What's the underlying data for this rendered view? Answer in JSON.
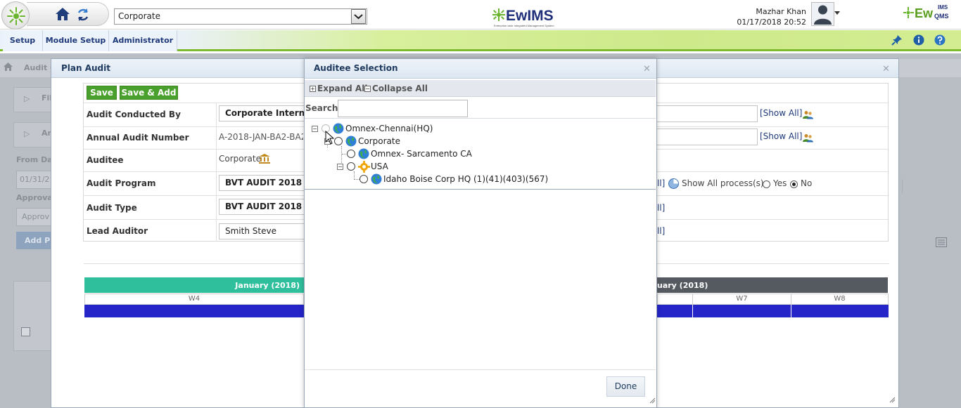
{
  "header": {
    "org_select_value": "Corporate",
    "center_logo": "EwIMS",
    "center_logo_tagline": "Enterprise wide Integrated Management System",
    "right_logo": "Ew",
    "right_logo_suffix": "QMS",
    "right_logo_top": "IMS",
    "user_name": "Mazhar Khan",
    "user_datetime": "01/17/2018 20:52"
  },
  "menu": {
    "items": [
      {
        "label": "Setup"
      },
      {
        "label": "Module Setup"
      },
      {
        "label": "Administrator"
      }
    ]
  },
  "background_page": {
    "breadcrumb": "Audit C",
    "filter_label": "Fil",
    "annual_label": "An",
    "from_date_label": "From Da",
    "from_date_value": "01/31/2",
    "approval_label": "Approva",
    "approval_placeholder": "Approv",
    "add_button": "Add P"
  },
  "plan_audit": {
    "title": "Plan Audit",
    "save_label": "Save",
    "save_add_label": "Save & Add",
    "show_all_label": "[Show All]",
    "rows": [
      {
        "label": "Audit Conducted By",
        "value": "Corporate Intern"
      },
      {
        "label": "Annual Audit Number",
        "value": "A-2018-JAN-BA2-BA2-A"
      },
      {
        "label": "Auditee",
        "value": "Corporate"
      },
      {
        "label": "Audit Program",
        "value": "BVT AUDIT 2018"
      },
      {
        "label": "Audit Type",
        "value": "BVT AUDIT 2018"
      },
      {
        "label": "Lead Auditor",
        "value": "Smith Steve"
      }
    ],
    "show_all_process_label": "Show All process(s) :",
    "process_yes": "Yes",
    "process_no": "No",
    "bracket_suffix": "ll]",
    "timeline": {
      "month_left": "January (2018)",
      "month_right": "uary (2018)",
      "weeks": [
        "W4",
        "W7",
        "W8"
      ]
    }
  },
  "auditee_selection": {
    "title": "Auditee Selection",
    "expand_all": "Expand All",
    "collapse_all": "Collapse All",
    "search_label": "Search:",
    "search_value": "",
    "tree": [
      {
        "label": "Omnex-Chennai(HQ)"
      },
      {
        "label": "Corporate"
      },
      {
        "label": "Omnex- Sarcamento CA"
      },
      {
        "label": "USA"
      },
      {
        "label": "Idaho Boise Corp HQ (1)(41)(403)(567)"
      }
    ],
    "done_label": "Done"
  },
  "colors": {
    "accent_green": "#4aa02c",
    "timeline_teal": "#2fbf9c",
    "timeline_dark": "#555a61",
    "bar_blue": "#2525c8",
    "menu_text": "#1f3a7a"
  }
}
